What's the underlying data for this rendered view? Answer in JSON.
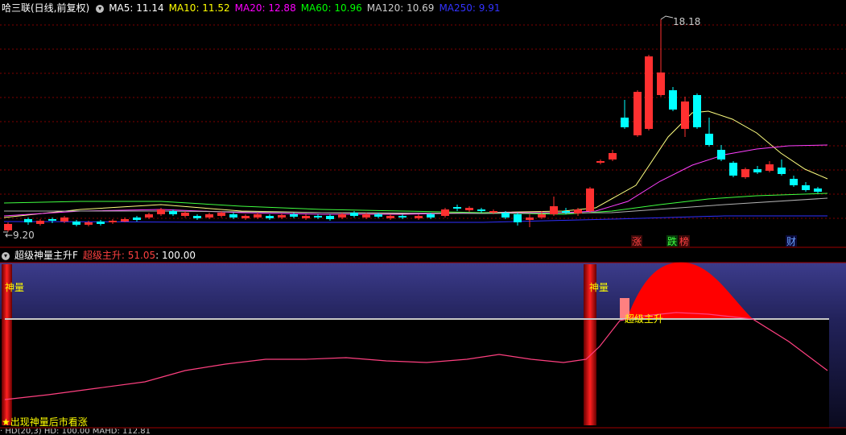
{
  "header": {
    "title": "哈三联(日线,前复权)",
    "ma": [
      {
        "label": "MA5: 11.14",
        "color": "#ffffff"
      },
      {
        "label": "MA10: 11.52",
        "color": "#ffff00"
      },
      {
        "label": "MA20: 12.88",
        "color": "#ff00ff"
      },
      {
        "label": "MA60: 10.96",
        "color": "#00ff00"
      },
      {
        "label": "MA120: 10.69",
        "color": "#cccccc"
      },
      {
        "label": "MA250: 9.91",
        "color": "#3333ff"
      }
    ]
  },
  "price": {
    "high_label": "18.18",
    "low_label": "9.20",
    "tags": [
      {
        "text": "涨",
        "bg": "#3a0a0a",
        "color": "#ff4040"
      },
      {
        "text": "跌",
        "bg": "#083a0a",
        "color": "#40ff40"
      },
      {
        "text": "榜",
        "bg": "#3a0a0a",
        "color": "#ff4040"
      },
      {
        "text": "财",
        "bg": "#0a0a3a",
        "color": "#6aa0ff"
      }
    ]
  },
  "indicator": {
    "name": "超级神量主升F",
    "value_label": "超级主升: 51.05",
    "ref_label": ": 100.00",
    "signal_labels": [
      "神量",
      "神量"
    ],
    "rise_label": "超级主升",
    "bottom_note": "出现神量后市看涨"
  },
  "footer": {
    "truncated": "· HD(20,3) HD: 100.00 MAHD: 112.81"
  },
  "colors": {
    "up": "#ff3030",
    "down": "#00ffff",
    "grid": "#800000",
    "axis": "#a00000"
  }
}
